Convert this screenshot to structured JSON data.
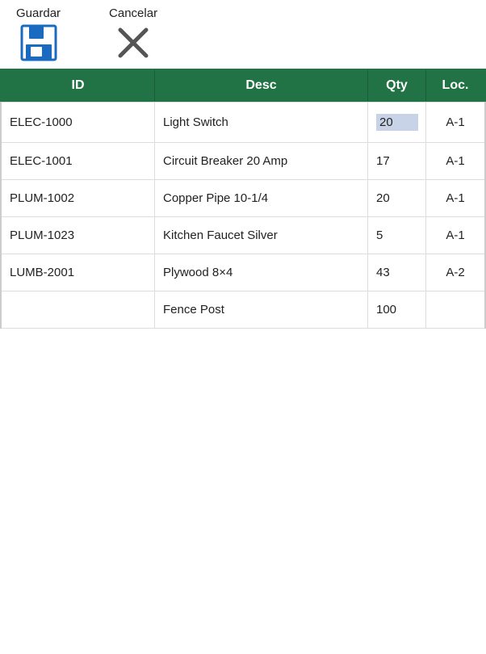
{
  "toolbar": {
    "save_label": "Guardar",
    "cancel_label": "Cancelar"
  },
  "table": {
    "headers": {
      "id": "ID",
      "desc": "Desc",
      "qty": "Qty",
      "loc": "Loc."
    },
    "rows": [
      {
        "id": "ELEC-1000",
        "desc": "Light Switch",
        "qty": "20",
        "loc": "A-1",
        "qty_active": true
      },
      {
        "id": "ELEC-1001",
        "desc": "Circuit Breaker 20 Amp",
        "qty": "17",
        "loc": "A-1",
        "qty_active": false
      },
      {
        "id": "PLUM-1002",
        "desc": "Copper Pipe 10-1/4",
        "qty": "20",
        "loc": "A-1",
        "qty_active": false
      },
      {
        "id": "PLUM-1023",
        "desc": "Kitchen Faucet Silver",
        "qty": "5",
        "loc": "A-1",
        "qty_active": false
      },
      {
        "id": "LUMB-2001",
        "desc": "Plywood 8×4",
        "qty": "43",
        "loc": "A-2",
        "qty_active": false
      },
      {
        "id": "",
        "desc": "Fence Post",
        "qty": "100",
        "loc": "",
        "qty_active": false
      }
    ]
  }
}
